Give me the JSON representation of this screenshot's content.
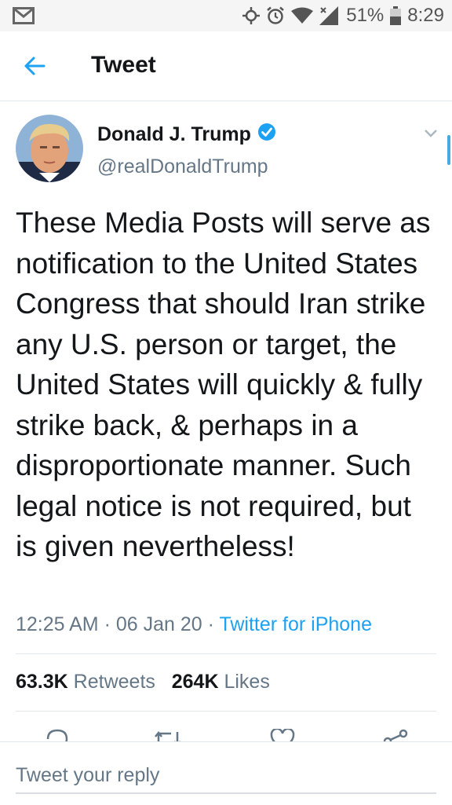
{
  "status_bar": {
    "battery": "51%",
    "time": "8:29"
  },
  "header": {
    "title": "Tweet"
  },
  "tweet": {
    "author_name": "Donald J. Trump",
    "author_handle": "@realDonaldTrump",
    "verified": true,
    "text": "These Media Posts will serve as notification to the United States Congress that should Iran strike any U.S. person or target, the United States will quickly & fully strike back, & perhaps in a disproportionate manner. Such legal notice is not required, but is given nevertheless!",
    "time": "12:25 AM",
    "date": "06 Jan 20",
    "source": "Twitter for iPhone",
    "retweets_count": "63.3K",
    "retweets_label": "Retweets",
    "likes_count": "264K",
    "likes_label": "Likes"
  },
  "reply": {
    "placeholder": "Tweet your reply"
  },
  "colors": {
    "accent": "#1da1f2",
    "secondary_text": "#657786",
    "divider": "#e1e8ed"
  },
  "icons": [
    "gmail-icon",
    "location-icon",
    "alarm-icon",
    "wifi-icon",
    "signal-icon",
    "battery-icon",
    "back-arrow-icon",
    "verified-badge-icon",
    "chevron-down-icon",
    "reply-icon",
    "retweet-icon",
    "like-icon",
    "share-icon"
  ]
}
